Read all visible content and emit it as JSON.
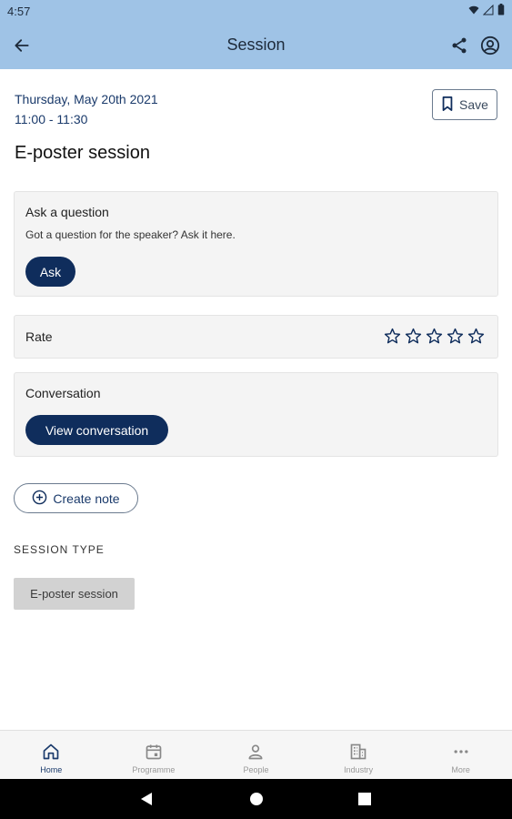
{
  "status_bar": {
    "time": "4:57"
  },
  "app_bar": {
    "title": "Session"
  },
  "session": {
    "date": "Thursday, May 20th 2021",
    "time_range": "11:00 - 11:30",
    "title": "E-poster session",
    "save_label": "Save"
  },
  "ask": {
    "title": "Ask a question",
    "subtitle": "Got a question for the speaker? Ask it here.",
    "button_label": "Ask"
  },
  "rate": {
    "label": "Rate",
    "rating": 0,
    "max": 5
  },
  "conversation": {
    "title": "Conversation",
    "button_label": "View conversation"
  },
  "note": {
    "button_label": "Create note"
  },
  "session_type": {
    "heading": "SESSION TYPE",
    "value": "E-poster session"
  },
  "bottom_nav": {
    "items": [
      {
        "label": "Home",
        "icon": "home-icon",
        "active": true
      },
      {
        "label": "Programme",
        "icon": "calendar-icon",
        "active": false
      },
      {
        "label": "People",
        "icon": "person-icon",
        "active": false
      },
      {
        "label": "Industry",
        "icon": "building-icon",
        "active": false
      },
      {
        "label": "More",
        "icon": "more-icon",
        "active": false
      }
    ]
  },
  "colors": {
    "app_bar": "#9fc3e6",
    "primary": "#0f2d5c",
    "accent_text": "#1a3a6b"
  }
}
